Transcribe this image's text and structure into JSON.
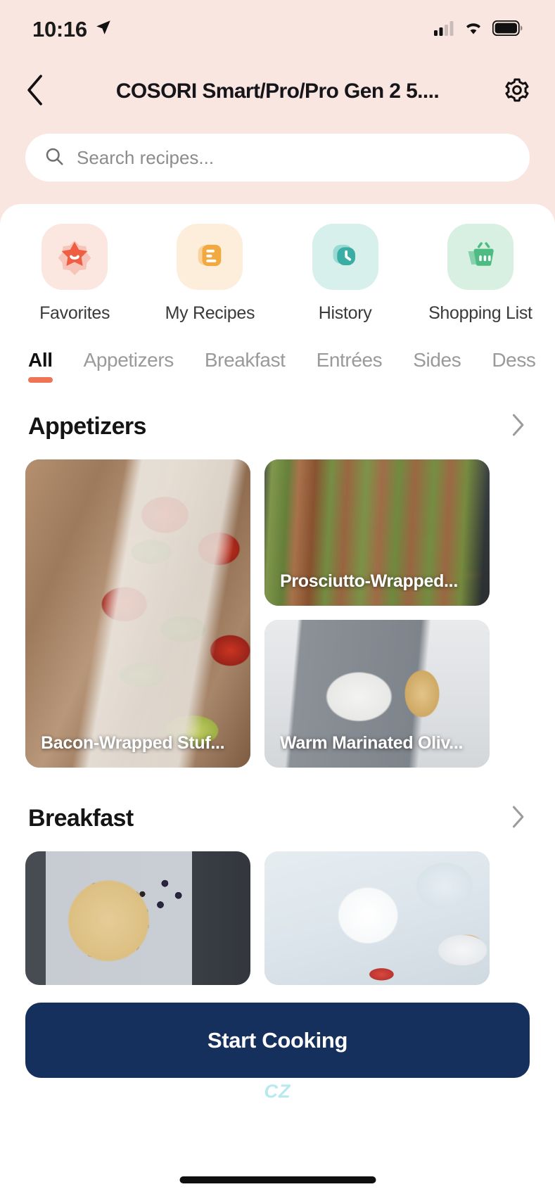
{
  "status_bar": {
    "time": "10:16",
    "location_icon": "location-arrow-icon",
    "cellular_icon": "cellular-bars-icon",
    "wifi_icon": "wifi-icon",
    "battery_icon": "battery-full-icon"
  },
  "nav": {
    "back_icon": "chevron-left-icon",
    "title": "COSORI Smart/Pro/Pro Gen 2 5....",
    "settings_icon": "gear-icon"
  },
  "search": {
    "placeholder": "Search recipes...",
    "value": "",
    "icon": "search-icon"
  },
  "quick_actions": [
    {
      "label": "Favorites",
      "icon": "star-smile-icon",
      "theme": "q-fav"
    },
    {
      "label": "My Recipes",
      "icon": "notebook-icon",
      "theme": "q-mine"
    },
    {
      "label": "History",
      "icon": "clock-icon",
      "theme": "q-hist"
    },
    {
      "label": "Shopping List",
      "icon": "basket-icon",
      "theme": "q-shop"
    }
  ],
  "tabs": {
    "items": [
      {
        "label": "All",
        "active": true
      },
      {
        "label": "Appetizers",
        "active": false
      },
      {
        "label": "Breakfast",
        "active": false
      },
      {
        "label": "Entrées",
        "active": false
      },
      {
        "label": "Sides",
        "active": false
      },
      {
        "label": "Dess",
        "active": false
      }
    ],
    "active_indicator_color": "#ef7453"
  },
  "sections": [
    {
      "title": "Appetizers",
      "chevron_icon": "chevron-right-icon",
      "cards": [
        {
          "title": "Bacon-Wrapped Stuf...",
          "image": "bacon-wrapped-stuffed-jalapenos-photo"
        },
        {
          "title": "Prosciutto-Wrapped...",
          "image": "prosciutto-wrapped-asparagus-photo"
        },
        {
          "title": "Warm Marinated Oliv...",
          "image": "warm-marinated-olives-photo"
        }
      ]
    },
    {
      "title": "Breakfast",
      "chevron_icon": "chevron-right-icon",
      "cards": [
        {
          "title": "",
          "image": "blueberry-scones-photo"
        },
        {
          "title": "",
          "image": "tea-and-scones-photo"
        }
      ]
    }
  ],
  "cta": {
    "label": "Start Cooking",
    "color": "#16305d"
  },
  "watermark": "CZ",
  "colors": {
    "page_background": "#fae6e0",
    "sheet_background": "#ffffff",
    "accent": "#ef7453",
    "cta": "#16305d"
  }
}
